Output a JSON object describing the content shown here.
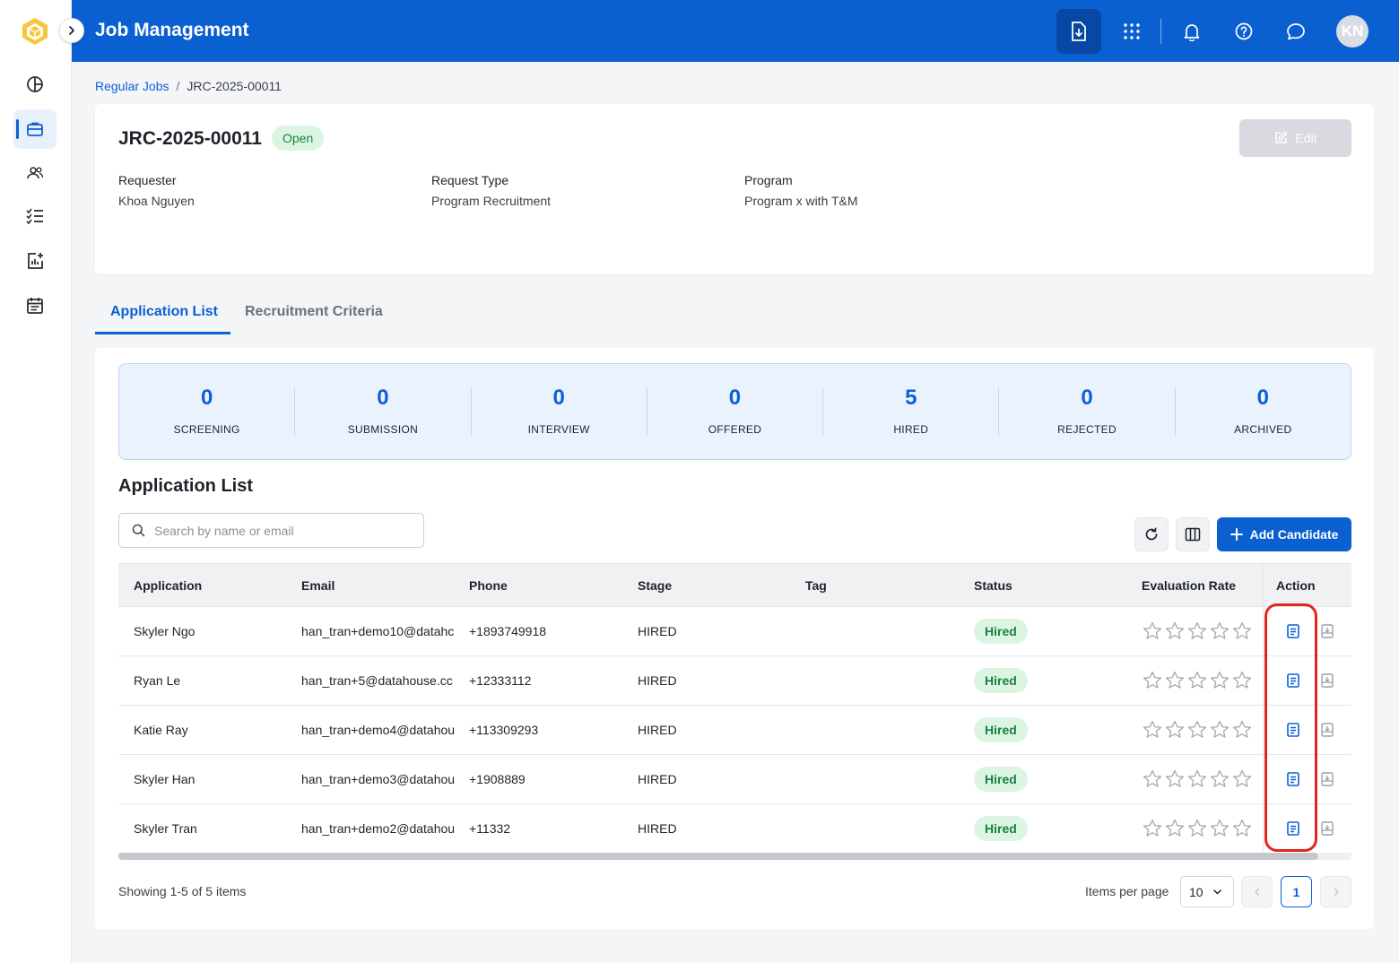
{
  "app": {
    "title": "Job Management",
    "avatar_initials": "KN"
  },
  "sidebar": {
    "items": [
      {
        "name": "dashboard"
      },
      {
        "name": "jobs",
        "active": true
      },
      {
        "name": "candidates"
      },
      {
        "name": "tasks"
      },
      {
        "name": "reports"
      },
      {
        "name": "calendar"
      }
    ]
  },
  "breadcrumb": {
    "parent": "Regular Jobs",
    "separator": "/",
    "current": "JRC-2025-00011"
  },
  "job": {
    "id": "JRC-2025-00011",
    "status": "Open",
    "edit_label": "Edit",
    "fields": [
      {
        "label": "Requester",
        "value": "Khoa Nguyen"
      },
      {
        "label": "Request Type",
        "value": "Program Recruitment"
      },
      {
        "label": "Program",
        "value": "Program x with T&M"
      }
    ]
  },
  "tabs": [
    {
      "label": "Application List",
      "active": true
    },
    {
      "label": "Recruitment Criteria",
      "active": false
    }
  ],
  "stats": [
    {
      "label": "SCREENING",
      "value": "0"
    },
    {
      "label": "SUBMISSION",
      "value": "0"
    },
    {
      "label": "INTERVIEW",
      "value": "0"
    },
    {
      "label": "OFFERED",
      "value": "0"
    },
    {
      "label": "HIRED",
      "value": "5"
    },
    {
      "label": "REJECTED",
      "value": "0"
    },
    {
      "label": "ARCHIVED",
      "value": "0"
    }
  ],
  "application_list": {
    "title": "Application List",
    "search_placeholder": "Search by name or email",
    "add_label": "Add Candidate",
    "columns": [
      "Application",
      "Email",
      "Phone",
      "Stage",
      "Tag",
      "Status",
      "Evaluation Rate",
      "Action"
    ],
    "rows": [
      {
        "name": "Skyler Ngo",
        "email": "han_tran+demo10@datahc",
        "phone": "+1893749918",
        "stage": "HIRED",
        "tag": "",
        "status": "Hired",
        "rating": 0
      },
      {
        "name": "Ryan Le",
        "email": "han_tran+5@datahouse.cc",
        "phone": "+12333112",
        "stage": "HIRED",
        "tag": "",
        "status": "Hired",
        "rating": 0
      },
      {
        "name": "Katie Ray",
        "email": "han_tran+demo4@datahou",
        "phone": "+113309293",
        "stage": "HIRED",
        "tag": "",
        "status": "Hired",
        "rating": 0
      },
      {
        "name": "Skyler Han",
        "email": "han_tran+demo3@datahou",
        "phone": "+1908889",
        "stage": "HIRED",
        "tag": "",
        "status": "Hired",
        "rating": 0
      },
      {
        "name": "Skyler Tran",
        "email": "han_tran+demo2@datahou",
        "phone": "+11332",
        "stage": "HIRED",
        "tag": "",
        "status": "Hired",
        "rating": 0
      }
    ]
  },
  "pagination": {
    "summary": "Showing 1-5 of 5 items",
    "items_per_page_label": "Items per page",
    "items_per_page": "10",
    "current_page": "1"
  },
  "colors": {
    "primary": "#0a5fd1",
    "success_bg": "#dcf5e3",
    "success_text": "#18813f",
    "highlight": "#e3261c"
  }
}
